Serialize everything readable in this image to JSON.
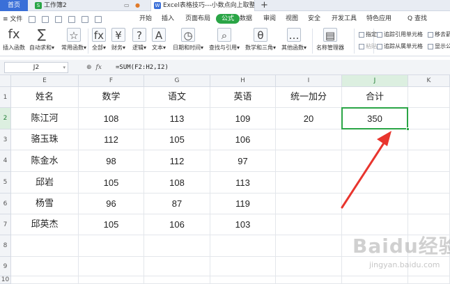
{
  "tabs": {
    "home": "首页",
    "workbook": "工作簿2",
    "workbook_badge": "S",
    "doc": "Excel表格技巧---小数点向上取整",
    "doc_badge": "W",
    "new_tab": "+"
  },
  "menu": {
    "file": "≡ 文件",
    "items": [
      "开始",
      "插入",
      "页面布局",
      "公式",
      "数据",
      "审阅",
      "视图",
      "安全",
      "开发工具",
      "特色应用",
      "Q 查找"
    ],
    "active_index": 3
  },
  "ribbon": {
    "buttons": [
      {
        "label": "插入函数",
        "icon": "fx-icon",
        "glyph": "fx"
      },
      {
        "label": "自动求和▾",
        "icon": "sum-icon",
        "glyph": "∑"
      },
      {
        "label": "常用函数▾",
        "icon": "common-function-icon",
        "glyph": "☆"
      },
      {
        "label": "全部▾",
        "icon": "all-functions-icon",
        "glyph": "fx"
      },
      {
        "label": "财务▾",
        "icon": "finance-icon",
        "glyph": "¥"
      },
      {
        "label": "逻辑▾",
        "icon": "logic-icon",
        "glyph": "?"
      },
      {
        "label": "文本▾",
        "icon": "text-icon",
        "glyph": "A"
      },
      {
        "label": "日期和时间▾",
        "icon": "datetime-icon",
        "glyph": "◷"
      },
      {
        "label": "查找与引用▾",
        "icon": "lookup-icon",
        "glyph": "⌕"
      },
      {
        "label": "数学和三角▾",
        "icon": "math-icon",
        "glyph": "θ"
      },
      {
        "label": "其他函数▾",
        "icon": "other-functions-icon",
        "glyph": "…"
      },
      {
        "label": "名称管理器",
        "icon": "name-manager-icon",
        "glyph": "▤"
      }
    ],
    "small": [
      {
        "label": "指定",
        "icon": "define-name-icon"
      },
      {
        "label": "粘贴",
        "icon": "paste-name-icon"
      },
      {
        "label": "追踪引用单元格",
        "icon": "trace-precedents-icon"
      },
      {
        "label": "追踪从属单元格",
        "icon": "trace-dependents-icon"
      },
      {
        "label": "移去箭",
        "icon": "remove-arrows-icon"
      },
      {
        "label": "显示公",
        "icon": "show-formulas-icon"
      }
    ]
  },
  "formula_bar": {
    "name_box": "J2",
    "fx_label": "fx",
    "formula": "=SUM(F2:H2,I2)"
  },
  "sheet": {
    "columns": [
      "E",
      "F",
      "G",
      "H",
      "I",
      "J",
      "K"
    ],
    "row_numbers": [
      "1",
      "2",
      "3",
      "4",
      "5",
      "6",
      "7",
      "8",
      "9",
      "10"
    ],
    "selected_column": "J",
    "selected_row": "2",
    "header_row": [
      "姓名",
      "数学",
      "语文",
      "英语",
      "统一加分",
      "合计"
    ],
    "rows": [
      [
        "陈江河",
        "108",
        "113",
        "109",
        "20",
        "350"
      ],
      [
        "骆玉珠",
        "112",
        "105",
        "106",
        "",
        ""
      ],
      [
        "陈金水",
        "98",
        "112",
        "97",
        "",
        ""
      ],
      [
        "邱岩",
        "105",
        "108",
        "113",
        "",
        ""
      ],
      [
        "杨雪",
        "96",
        "87",
        "119",
        "",
        ""
      ],
      [
        "邱英杰",
        "105",
        "106",
        "103",
        "",
        ""
      ]
    ]
  },
  "watermark": {
    "main": "Baidu经验",
    "sub": "jingyan.baidu.com"
  },
  "colors": {
    "accent_green": "#2aa546",
    "tab_blue": "#3a6fd8",
    "arrow_red": "#e8352e"
  }
}
